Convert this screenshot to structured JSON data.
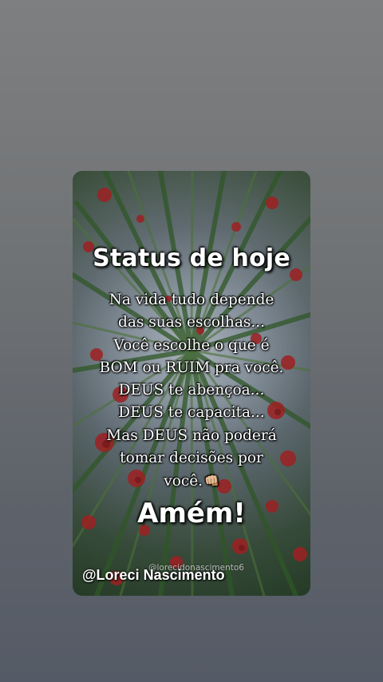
{
  "post": {
    "title": "Status de hoje",
    "lines": [
      "Na vida tudo depende",
      "das suas escolhas...",
      "Você escolhe o que é",
      "BOM ou RUIM pra você.",
      "DEUS te abençoa...",
      "DEUS te capacita...",
      "Mas DEUS não poderá",
      "tomar decisões por",
      "você."
    ],
    "closing": "Amém!",
    "watermark_small": "@lorecidonascimento6",
    "watermark_main": "@Loreci Nascimento",
    "emoji": "👊🏼"
  },
  "colors": {
    "page_background": "#6f7274",
    "text": "#ffffff",
    "flower_red": "#c0282a",
    "foliage_green": "#3f6b35"
  }
}
